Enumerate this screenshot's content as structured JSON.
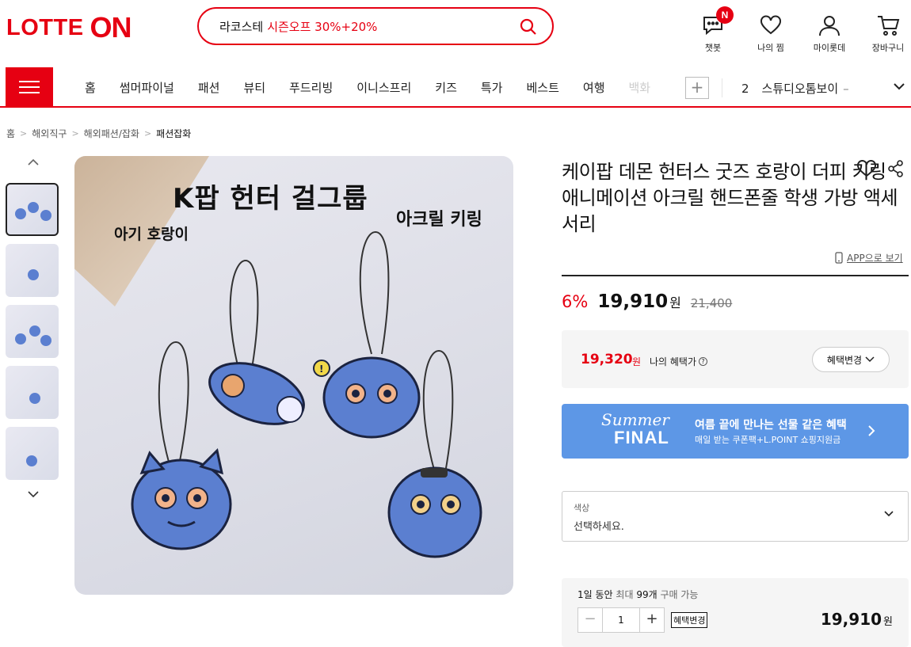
{
  "header": {
    "logo": {
      "part1": "LOTTE",
      "part2": "ON"
    },
    "search": {
      "keyword": "라코스테",
      "promo": "시즌오프 30%+20%"
    },
    "icons": [
      {
        "label": "챗봇",
        "icon": "chatbot-icon",
        "badge": "N"
      },
      {
        "label": "나의 찜",
        "icon": "heart-icon"
      },
      {
        "label": "마이롯데",
        "icon": "person-icon"
      },
      {
        "label": "장바구니",
        "icon": "cart-icon"
      }
    ]
  },
  "nav": {
    "items": [
      "홈",
      "썸머파이널",
      "패션",
      "뷰티",
      "푸드리빙",
      "이니스프리",
      "키즈",
      "특가",
      "베스트",
      "여행",
      "백화"
    ],
    "plus": "+",
    "ranking": {
      "number": "2",
      "keyword": "스튜디오톰보이",
      "trend": "–"
    }
  },
  "breadcrumb": [
    "홈",
    "해외직구",
    "해외패션/잡화",
    "패션잡화"
  ],
  "gallery": {
    "text_main": "K팝 헌터 걸그룹",
    "text_right": "아크릴 키링",
    "text_left": "아기 호랑이",
    "thumb_count": 5,
    "active_thumb": 0
  },
  "product": {
    "title": "케이팝 데몬 헌터스 굿즈 호랑이 더피 키링 애니메이션 아크릴 핸드폰줄 학생 가방 액세서리",
    "app_link": "APP으로 보기",
    "discount_rate": "6%",
    "price": "19,910",
    "won": "원",
    "original_price": "21,400",
    "benefit_price": "19,320",
    "benefit_label": "나의 혜택가",
    "benefit_button": "혜택변경",
    "banner": {
      "script1": "Summer",
      "script2": "FINAL",
      "title": "여름 끝에 만나는 선물 같은 혜택",
      "subtitle": "매일 받는 쿠폰팩+L.POINT 쇼핑지원금"
    },
    "option": {
      "label": "색상",
      "placeholder": "선택하세요."
    },
    "purchase": {
      "limit_prefix": "1일 동안",
      "limit_mid": "최대",
      "limit_count": "99개",
      "limit_suffix": "구매 가능",
      "quantity": "1",
      "minus": "−",
      "plus": "+",
      "tag": "혜택변경",
      "total": "19,910",
      "won": "원"
    }
  },
  "colors": {
    "brand": "#e60012",
    "banner": "#5d97e6",
    "tiger": "#5b7fd0"
  }
}
